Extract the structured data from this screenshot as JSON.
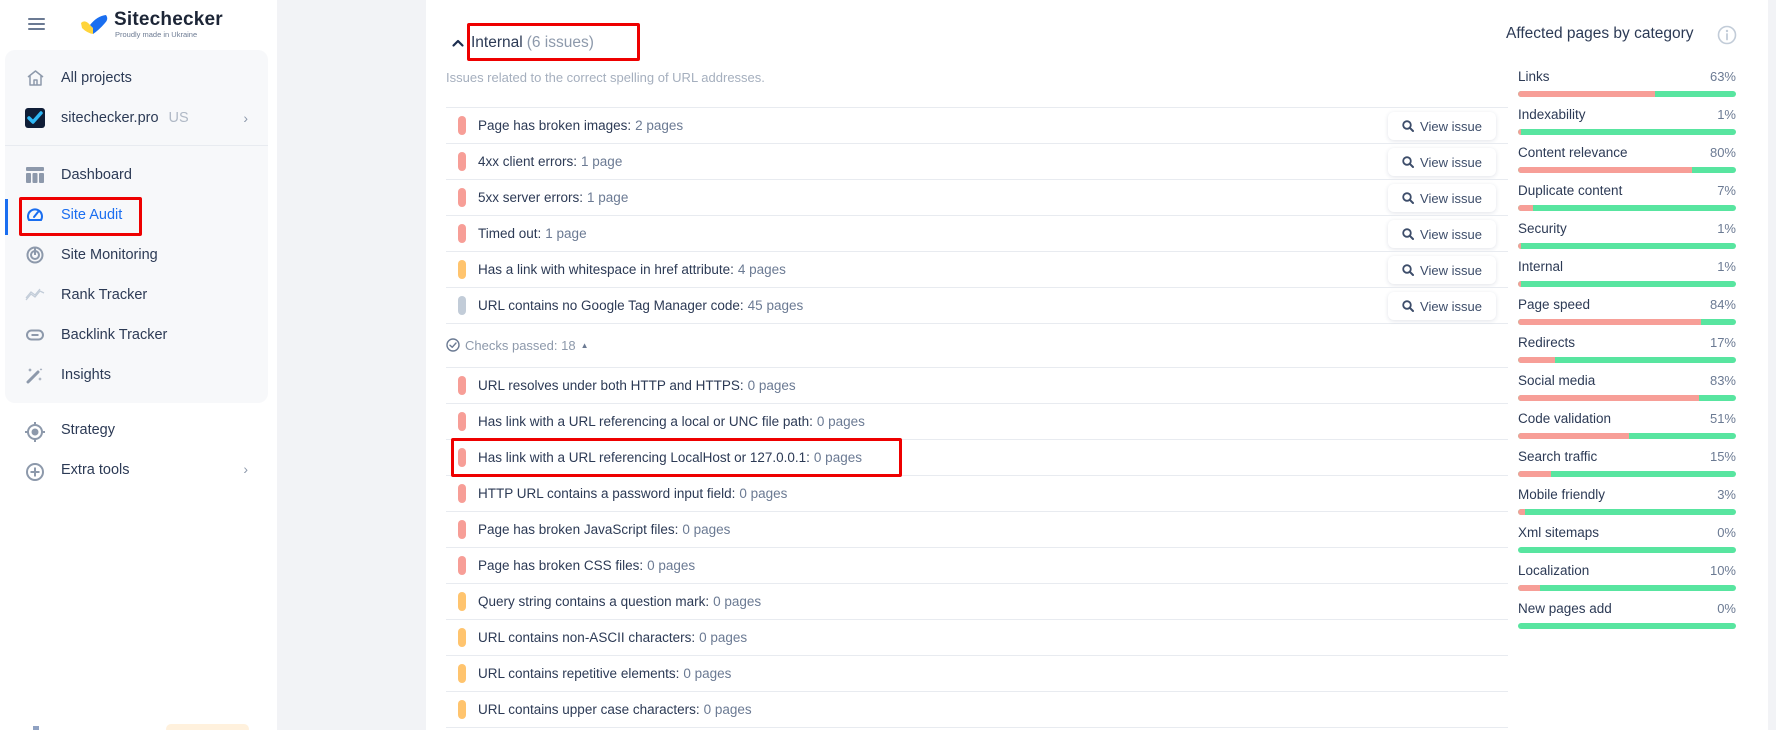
{
  "app": {
    "brand": "Sitechecker",
    "tagline": "Proudly made in Ukraine"
  },
  "sidebar": {
    "items": [
      {
        "label": "All projects",
        "icon": "home-icon"
      },
      {
        "label": "sitechecker.pro",
        "tag": "US",
        "icon": "project-logo-icon",
        "has_chevron": true
      },
      {
        "label": "Dashboard",
        "icon": "dashboard-icon"
      },
      {
        "label": "Site Audit",
        "icon": "speedometer-icon",
        "active": true
      },
      {
        "label": "Site Monitoring",
        "icon": "monitoring-icon"
      },
      {
        "label": "Rank Tracker",
        "icon": "chart-line-icon"
      },
      {
        "label": "Backlink Tracker",
        "icon": "link-icon"
      },
      {
        "label": "Insights",
        "icon": "magic-wand-icon"
      }
    ],
    "extra": [
      {
        "label": "Strategy",
        "icon": "target-icon"
      },
      {
        "label": "Extra tools",
        "icon": "plus-circle-icon",
        "has_chevron": true
      }
    ],
    "chevron": "›"
  },
  "section": {
    "title": "Internal",
    "count": "(6 issues)",
    "description": "Issues related to the correct spelling of URL addresses."
  },
  "issues": [
    {
      "label": "Page has broken images:",
      "count": "2 pages",
      "severity": "error",
      "color": "#f79e97",
      "button": "View issue"
    },
    {
      "label": "4xx client errors:",
      "count": "1 page",
      "severity": "error",
      "color": "#f79e97",
      "button": "View issue"
    },
    {
      "label": "5xx server errors:",
      "count": "1 page",
      "severity": "error",
      "color": "#f79e97",
      "button": "View issue"
    },
    {
      "label": "Timed out:",
      "count": "1 page",
      "severity": "error",
      "color": "#f79e97",
      "button": "View issue"
    },
    {
      "label": "Has a link with whitespace in href attribute:",
      "count": "4 pages",
      "severity": "warning",
      "color": "#ffc46e",
      "button": "View issue"
    },
    {
      "label": "URL contains no Google Tag Manager code:",
      "count": "45 pages",
      "severity": "notice",
      "color": "#c2ccd8",
      "button": "View issue"
    }
  ],
  "checks": {
    "label": "Checks passed: 18",
    "items": [
      {
        "label": "URL resolves under both HTTP and HTTPS:",
        "count": "0 pages",
        "color": "#f79e97"
      },
      {
        "label": "Has link with a URL referencing a local or UNC file path:",
        "count": "0 pages",
        "color": "#f79e97"
      },
      {
        "label": "Has link with a URL referencing LocalHost or 127.0.0.1:",
        "count": "0 pages",
        "color": "#f79e97"
      },
      {
        "label": "HTTP URL contains a password input field:",
        "count": "0 pages",
        "color": "#f79e97"
      },
      {
        "label": "Page has broken JavaScript files:",
        "count": "0 pages",
        "color": "#f79e97"
      },
      {
        "label": "Page has broken CSS files:",
        "count": "0 pages",
        "color": "#f79e97"
      },
      {
        "label": "Query string contains a question mark:",
        "count": "0 pages",
        "color": "#ffc46e"
      },
      {
        "label": "URL contains non-ASCII characters:",
        "count": "0 pages",
        "color": "#ffc46e"
      },
      {
        "label": "URL contains repetitive elements:",
        "count": "0 pages",
        "color": "#ffc46e"
      },
      {
        "label": "URL contains upper case characters:",
        "count": "0 pages",
        "color": "#ffc46e"
      }
    ]
  },
  "categories": {
    "title": "Affected pages by category",
    "items": [
      {
        "label": "Links",
        "value": "63%",
        "percent": 63
      },
      {
        "label": "Indexability",
        "value": "1%",
        "percent": 1
      },
      {
        "label": "Content relevance",
        "value": "80%",
        "percent": 80
      },
      {
        "label": "Duplicate content",
        "value": "7%",
        "percent": 7
      },
      {
        "label": "Security",
        "value": "1%",
        "percent": 1
      },
      {
        "label": "Internal",
        "value": "1%",
        "percent": 1
      },
      {
        "label": "Page speed",
        "value": "84%",
        "percent": 84
      },
      {
        "label": "Redirects",
        "value": "17%",
        "percent": 17
      },
      {
        "label": "Social media",
        "value": "83%",
        "percent": 83
      },
      {
        "label": "Code validation",
        "value": "51%",
        "percent": 51
      },
      {
        "label": "Search traffic",
        "value": "15%",
        "percent": 15
      },
      {
        "label": "Mobile friendly",
        "value": "3%",
        "percent": 3
      },
      {
        "label": "Xml sitemaps",
        "value": "0%",
        "percent": 0
      },
      {
        "label": "Localization",
        "value": "10%",
        "percent": 10
      },
      {
        "label": "New pages add",
        "value": "0%",
        "percent": 0
      }
    ]
  },
  "colors": {
    "accent": "#1a6ef0",
    "error": "#f79e97",
    "warning": "#ffc46e",
    "notice": "#c2ccd8",
    "ok": "#58e5a0",
    "highlight": "#ee0000"
  }
}
